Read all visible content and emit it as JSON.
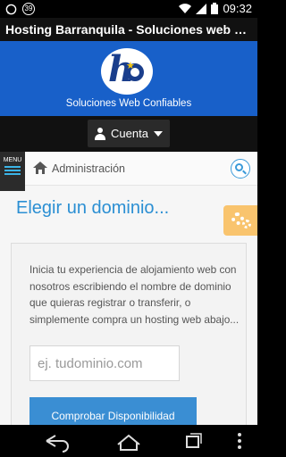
{
  "status_bar": {
    "notification_count": "39",
    "time": "09:32"
  },
  "title_bar": {
    "title": "Hosting Barranquila - Soluciones web co..."
  },
  "header": {
    "logo_letters": "ho",
    "tagline": "Soluciones Web Confiables"
  },
  "account": {
    "label": "Cuenta"
  },
  "breadcrumb": {
    "menu_label": "MENU",
    "current": "Administración"
  },
  "page": {
    "heading": "Elegir un dominio...",
    "description": "Inicia tu experiencia de alojamiento web con nosotros escribiendo el nombre de dominio que quieras registrar o transferir, o simplemente compra un hosting web abajo...",
    "domain_placeholder": "ej. tudominio.com",
    "check_button": "Comprobar Disponibilidad"
  },
  "colors": {
    "header_blue": "#1860c9",
    "accent_blue": "#3a8ed3",
    "settings_orange": "#f9c46e"
  },
  "icons": {
    "status": [
      "whatsapp-icon",
      "notification-badge-icon",
      "wifi-icon",
      "signal-icon",
      "battery-icon"
    ],
    "nav": [
      "back-icon",
      "home-icon",
      "recent-apps-icon",
      "overflow-menu-icon"
    ]
  }
}
